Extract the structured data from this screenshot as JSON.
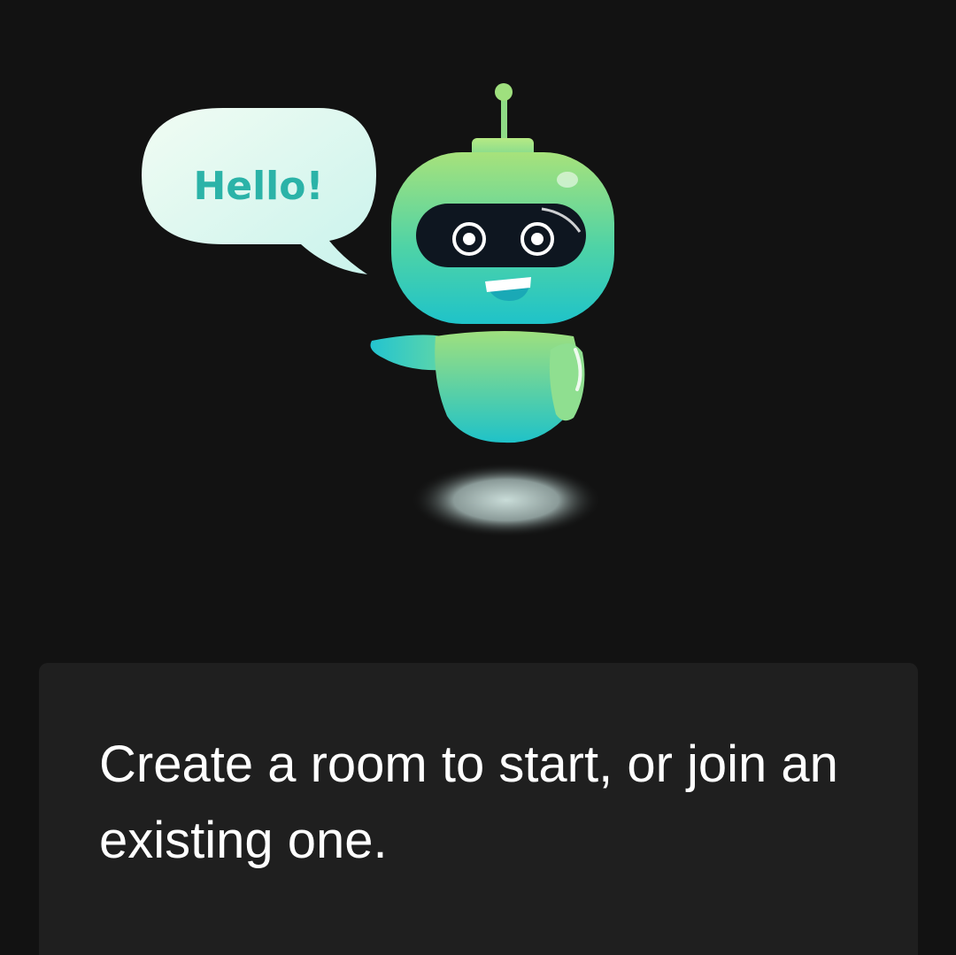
{
  "illustration": {
    "bubble_text": "Hello!",
    "icon": "robot-mascot-icon",
    "colors": {
      "robot_green": "#9be07a",
      "robot_teal": "#22c2c9",
      "bubble_text": "#2bb3a8",
      "bubble_fill": "#e6fbf4",
      "visor": "#0e1620"
    }
  },
  "card": {
    "message": "Create a room to start, or join an existing one."
  },
  "theme": {
    "background": "#121212",
    "card_background": "#1f1f1f",
    "text": "#ffffff"
  }
}
